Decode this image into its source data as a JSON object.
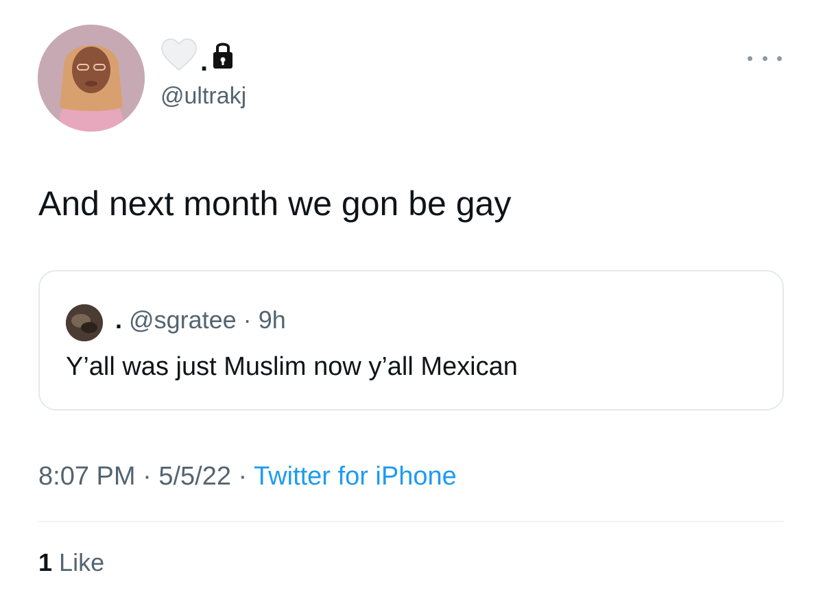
{
  "author": {
    "display_name_dot": ".",
    "handle": "@ultrakj",
    "avatar_icon": "profile-photo",
    "name_icons": [
      "white-heart-icon",
      "lock-icon"
    ]
  },
  "tweet": {
    "text": "And next month we gon be gay"
  },
  "quoted_tweet": {
    "dot": ".",
    "handle": "@sgratee",
    "separator": "·",
    "time": "9h",
    "text": "Y’all was just Muslim now y’all Mexican"
  },
  "meta": {
    "time": "8:07 PM",
    "separator": " · ",
    "date": "5/5/22",
    "source": "Twitter for iPhone"
  },
  "engagement": {
    "likes_count": "1",
    "likes_label": "Like"
  },
  "colors": {
    "secondary_text": "#536471",
    "link": "#1d9bf0",
    "border": "#e4e9ed"
  }
}
